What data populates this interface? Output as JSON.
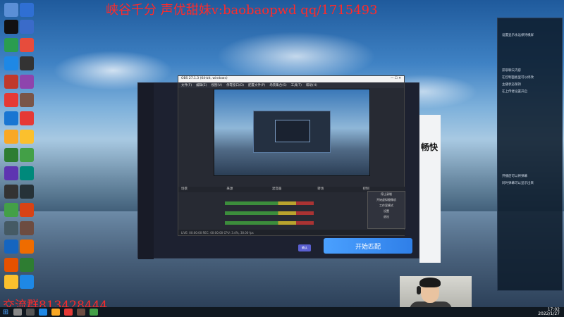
{
  "overlay": {
    "top_text": "峡谷千分 声优甜妹v:baobaopwd qq/1715493",
    "bottom_text": "交流群813428444"
  },
  "obs": {
    "title": "OBS 27.1.3 (64-bit, windows)",
    "menu": [
      "文件(F)",
      "编辑(E)",
      "视图(V)",
      "停靠窗口(D)",
      "配置文件(P)",
      "场景集合(S)",
      "工具(T)",
      "帮助(H)"
    ],
    "docks": [
      "场景",
      "来源",
      "混音器",
      "转场",
      "控制"
    ],
    "context_menu": [
      "停止录制",
      "开始虚拟摄像机",
      "工作室模式",
      "设置",
      "退出"
    ],
    "status": "LIVE: 00:00:00  REC: 00:00:00  CPU: 3.4%, 30.00 fps"
  },
  "app": {
    "start_button": "开始匹配",
    "small_button": "确认"
  },
  "banner": {
    "text": "畅快"
  },
  "side_panel": {
    "lines": [
      "设置显示永远保持横屏",
      "获取聊天内容",
      "在控制面板里可以修改",
      "主播状态保持",
      "在上传者设置开启",
      "开播后可以将弹幕",
      "同时弹幕可以显示出来"
    ]
  },
  "taskbar": {
    "time": "17:02",
    "date": "2022/1/27"
  }
}
